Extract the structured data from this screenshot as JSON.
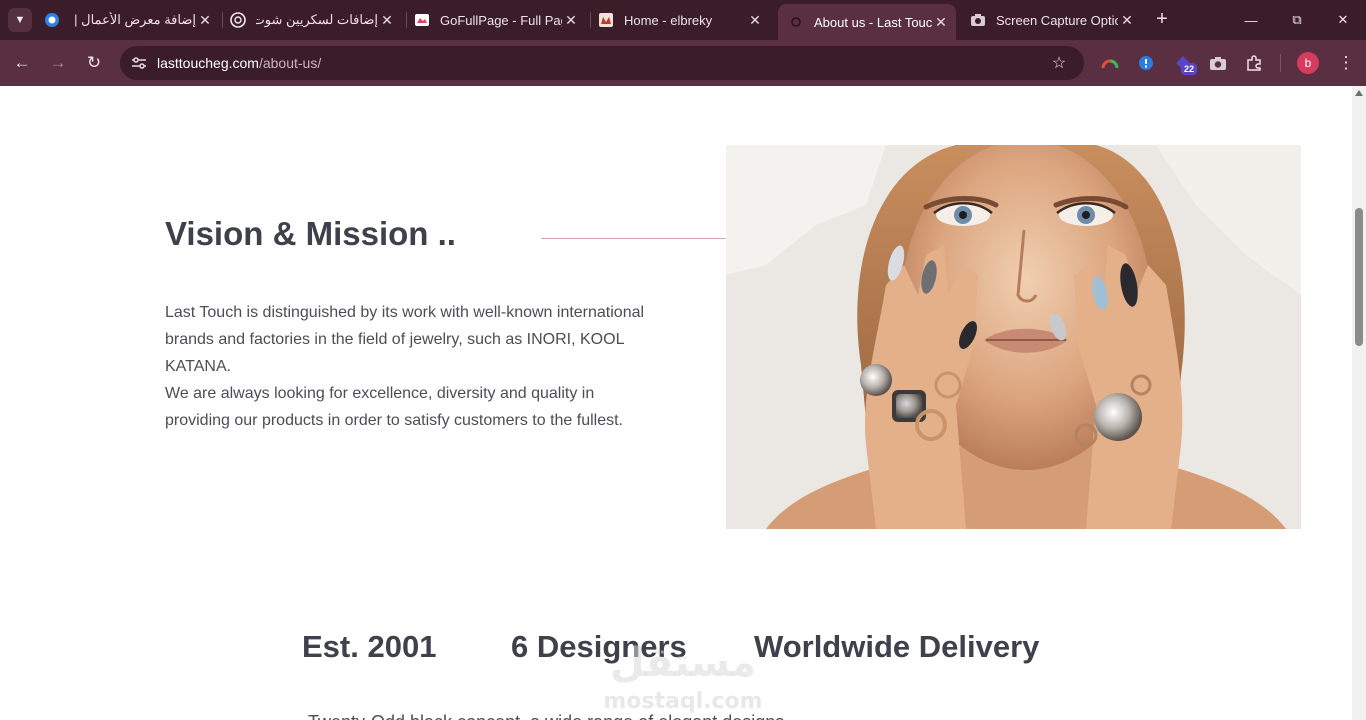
{
  "browser": {
    "tabs": [
      {
        "title": "إضافة معرض الأعمال | م",
        "favicon": "circle-logo-icon",
        "active": false
      },
      {
        "title": "إضافات لسكريين شوت",
        "favicon": "chatgpt-icon",
        "active": false
      },
      {
        "title": "GoFullPage - Full Page Screen Capture",
        "favicon": "gofullpage-icon",
        "active": false
      },
      {
        "title": "Home - elbreky",
        "favicon": "elbreky-icon",
        "active": false
      },
      {
        "title": "About us - Last Touch",
        "favicon": "lasttouch-icon",
        "active": true
      },
      {
        "title": "Screen Capture Options",
        "favicon": "camera-icon",
        "active": false
      }
    ],
    "url": {
      "host": "lasttoucheg.com",
      "path": "/about-us/"
    },
    "extension_badge": "22",
    "profile_initial": "b",
    "colors": {
      "frame": "#3a1d29",
      "toolbar": "#5a2f41",
      "profile": "#d63a5e"
    }
  },
  "page": {
    "vision": {
      "heading": "Vision & Mission ..",
      "paragraph_1": "Last Touch is distinguished by its work with well-known international brands and factories in the field of jewelry, such as INORI, KOOL KATANA.",
      "paragraph_2": "We are always looking for excellence, diversity and quality in providing our products in order to satisfy customers to the fullest."
    },
    "stats": [
      {
        "label": "Est. 2001"
      },
      {
        "label": "6 Designers"
      },
      {
        "label": "Worldwide Delivery"
      }
    ],
    "bottom_text": "Twenty-Odd black concept, a wide range of elegant designs"
  },
  "watermark": {
    "arabic": "مستقل",
    "latin": "mostaql.com"
  }
}
